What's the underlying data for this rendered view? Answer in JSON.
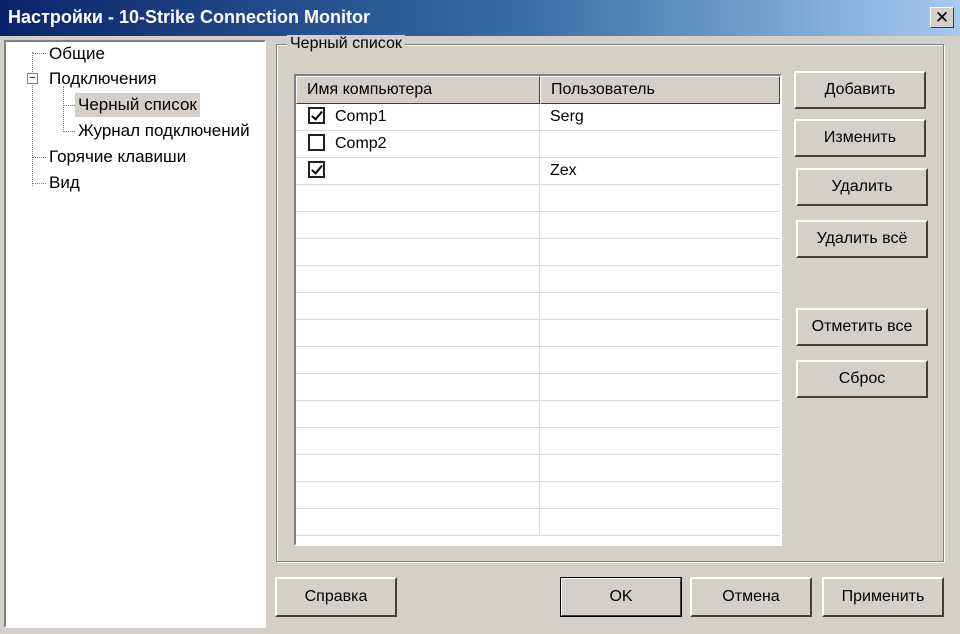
{
  "window": {
    "title": "Настройки - 10-Strike Connection Monitor",
    "close_glyph": "✕"
  },
  "tree": {
    "items": [
      {
        "label": "Общие"
      },
      {
        "label": "Подключения",
        "expander": "−"
      },
      {
        "label": "Черный список"
      },
      {
        "label": "Журнал подключений"
      },
      {
        "label": "Горячие клавиши"
      },
      {
        "label": "Вид"
      }
    ]
  },
  "blacklist": {
    "group_title": "Черный список",
    "columns": [
      "Имя компьютера",
      "Пользователь"
    ],
    "rows": [
      {
        "checked": true,
        "computer": "Comp1",
        "user": "Serg"
      },
      {
        "checked": false,
        "computer": "Comp2",
        "user": ""
      },
      {
        "checked": true,
        "computer": "",
        "user": "Zex"
      }
    ]
  },
  "side_buttons": {
    "add": "Добавить",
    "edit": "Изменить",
    "delete": "Удалить",
    "delete_all": "Удалить всё",
    "mark_all": "Отметить все",
    "reset": "Сброс"
  },
  "bottom_buttons": {
    "help": "Справка",
    "ok": "OK",
    "cancel": "Отмена",
    "apply": "Применить"
  }
}
